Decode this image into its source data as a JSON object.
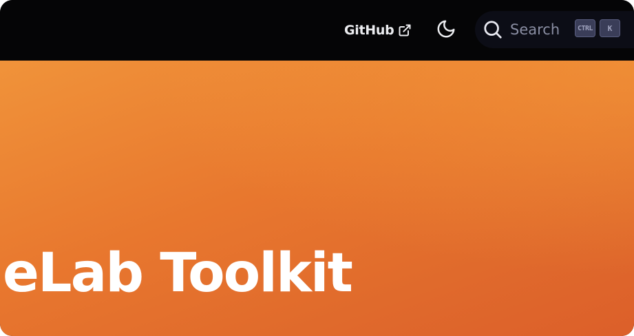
{
  "navbar": {
    "github": {
      "label": "GitHub",
      "icon": "external-link-icon"
    },
    "theme_toggle": {
      "icon": "moon-icon"
    },
    "search": {
      "icon": "search-icon",
      "placeholder": "Search",
      "shortcut_keys": [
        "CTRL",
        "K"
      ]
    }
  },
  "hero": {
    "title": "eLab Toolkit",
    "gradient_colors": [
      "#f0933a",
      "#e8772e",
      "#dc5f2a"
    ]
  }
}
